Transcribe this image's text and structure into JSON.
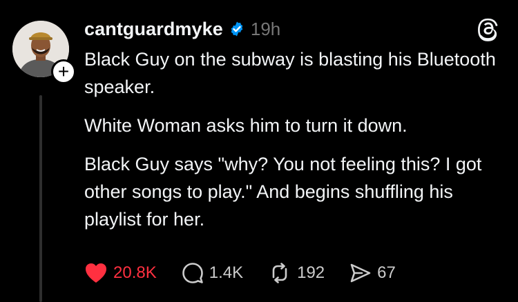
{
  "post": {
    "username": "cantguardmyke",
    "timestamp": "19h",
    "paragraphs": [
      "Black Guy on the subway is blasting his Bluetooth speaker.",
      "White Woman asks him to turn it down.",
      "Black Guy says \"why? You not feeling this? I got other songs to play.\" And begins shuffling his playlist for her."
    ]
  },
  "actions": {
    "likes": "20.8K",
    "comments": "1.4K",
    "reposts": "192",
    "shares": "67"
  },
  "avatar_badge": "+",
  "colors": {
    "background": "#000000",
    "text": "#f3f5f7",
    "muted": "#777777",
    "like": "#ff3040",
    "verified": "#0095f6"
  },
  "icons": [
    "verified-badge-icon",
    "threads-logo-icon",
    "heart-icon",
    "comment-icon",
    "repost-icon",
    "share-icon"
  ]
}
